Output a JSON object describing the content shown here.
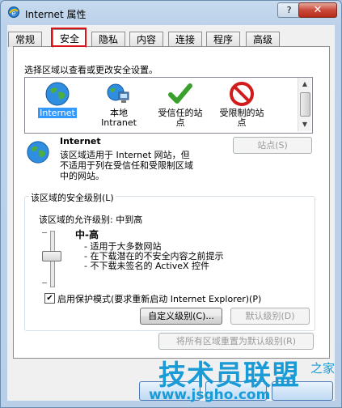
{
  "window": {
    "title": "Internet 属性",
    "help_label": "?",
    "close_label": "✕"
  },
  "tabs": [
    {
      "label": "常规",
      "active": false
    },
    {
      "label": "安全",
      "active": true
    },
    {
      "label": "隐私",
      "active": false
    },
    {
      "label": "内容",
      "active": false
    },
    {
      "label": "连接",
      "active": false
    },
    {
      "label": "程序",
      "active": false
    },
    {
      "label": "高级",
      "active": false
    }
  ],
  "security": {
    "instruction": "选择区域以查看或更改安全设置。",
    "zones": [
      {
        "label": "Internet",
        "icon": "globe-icon",
        "selected": true
      },
      {
        "label": "本地\nIntranet",
        "icon": "local-intranet-icon",
        "selected": false
      },
      {
        "label": "受信任的站\n点",
        "icon": "check-icon",
        "selected": false
      },
      {
        "label": "受限制的站\n点",
        "icon": "restricted-icon",
        "selected": false
      }
    ],
    "zone_title": "Internet",
    "zone_description": "该区域适用于 Internet 网站，但\n不适用于列在受信任和受限制区域\n中的网站。",
    "sites_button": "站点(S)",
    "level_group_title": "该区域的安全级别(L)",
    "allowed_levels": "该区域的允许级别: 中到高",
    "level_name": "中-高",
    "level_points": [
      "- 适用于大多数网站",
      "- 在下载潜在的不安全内容之前提示",
      "- 不下载未签名的 ActiveX 控件"
    ],
    "protected_mode_label": "启用保护模式(要求重新启动 Internet Explorer)(P)",
    "protected_mode_checked": true,
    "custom_level_button": "自定义级别(C)...",
    "default_level_button": "默认级别(D)",
    "reset_all_button": "将所有区域重置为默认级别(R)"
  },
  "watermark": {
    "main": "技术员联盟",
    "sub": "www.jsgho.com",
    "corner": "之家"
  },
  "colors": {
    "tab_highlight": "#d8141a",
    "selection": "#3399ff",
    "watermark": "#1a9bd6"
  }
}
